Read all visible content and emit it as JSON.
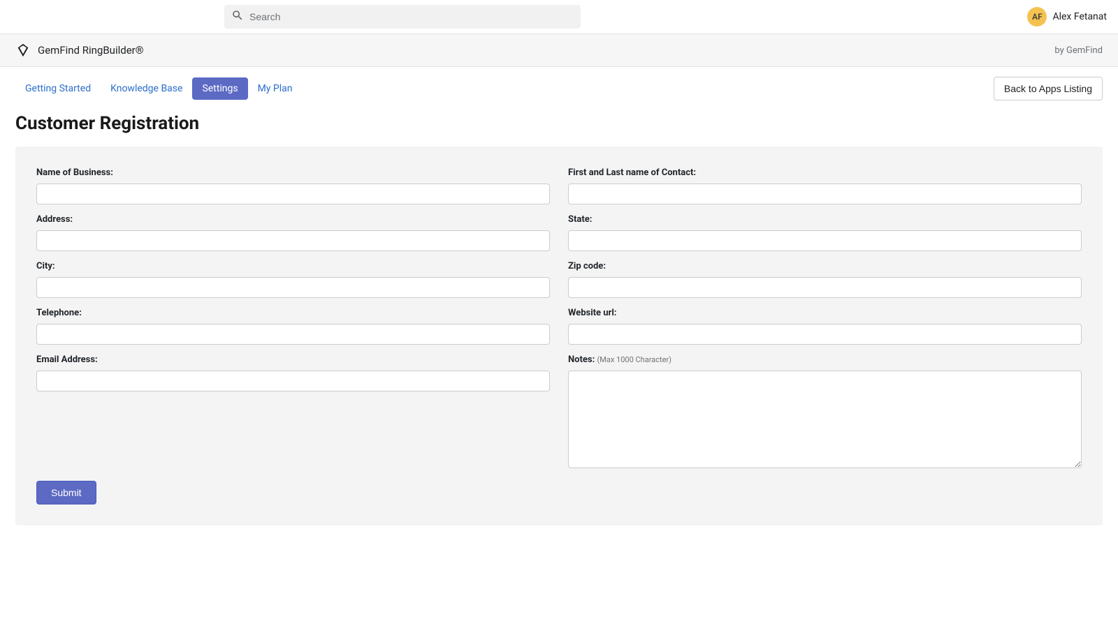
{
  "topbar": {
    "search_placeholder": "Search",
    "user_initials": "AF",
    "user_name": "Alex Fetanat"
  },
  "app_header": {
    "title": "GemFind RingBuilder®",
    "by_text": "by GemFind"
  },
  "nav": {
    "tabs": [
      {
        "label": "Getting Started",
        "active": false
      },
      {
        "label": "Knowledge Base",
        "active": false
      },
      {
        "label": "Settings",
        "active": true
      },
      {
        "label": "My Plan",
        "active": false
      }
    ],
    "back_button": "Back to Apps Listing"
  },
  "page": {
    "title": "Customer Registration"
  },
  "form": {
    "left": {
      "business_label": "Name of Business:",
      "business_value": "",
      "address_label": "Address:",
      "address_value": "",
      "city_label": "City:",
      "city_value": "",
      "telephone_label": "Telephone:",
      "telephone_value": "",
      "email_label": "Email Address:",
      "email_value": ""
    },
    "right": {
      "contact_label": "First and Last name of Contact:",
      "contact_value": "",
      "state_label": "State:",
      "state_value": "",
      "zip_label": "Zip code:",
      "zip_value": "",
      "website_label": "Website url:",
      "website_value": "",
      "notes_label": "Notes:",
      "notes_hint": "(Max 1000 Character)",
      "notes_value": ""
    },
    "submit_label": "Submit"
  }
}
